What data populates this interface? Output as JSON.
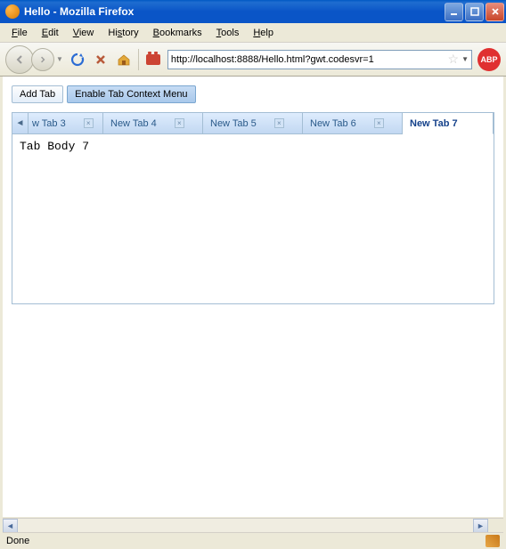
{
  "window": {
    "title": "Hello - Mozilla Firefox"
  },
  "menubar": {
    "items": [
      {
        "label": "File",
        "key": "F"
      },
      {
        "label": "Edit",
        "key": "E"
      },
      {
        "label": "View",
        "key": "V"
      },
      {
        "label": "History",
        "key": "s"
      },
      {
        "label": "Bookmarks",
        "key": "B"
      },
      {
        "label": "Tools",
        "key": "T"
      },
      {
        "label": "Help",
        "key": "H"
      }
    ],
    "file": "File",
    "edit": "Edit",
    "view": "View",
    "history": "History",
    "bookmarks": "Bookmarks",
    "tools": "Tools",
    "help": "Help"
  },
  "toolbar": {
    "url": "http://localhost:8888/Hello.html?gwt.codesvr=1",
    "abp_label": "ABP"
  },
  "app": {
    "add_tab_label": "Add Tab",
    "context_menu_label": "Enable Tab Context Menu",
    "tabs": [
      {
        "label": "w Tab 3"
      },
      {
        "label": "New Tab 4"
      },
      {
        "label": "New Tab 5"
      },
      {
        "label": "New Tab 6"
      },
      {
        "label": "New Tab 7"
      }
    ],
    "active_tab_index": 4,
    "body_text": "Tab Body 7"
  },
  "statusbar": {
    "text": "Done"
  }
}
